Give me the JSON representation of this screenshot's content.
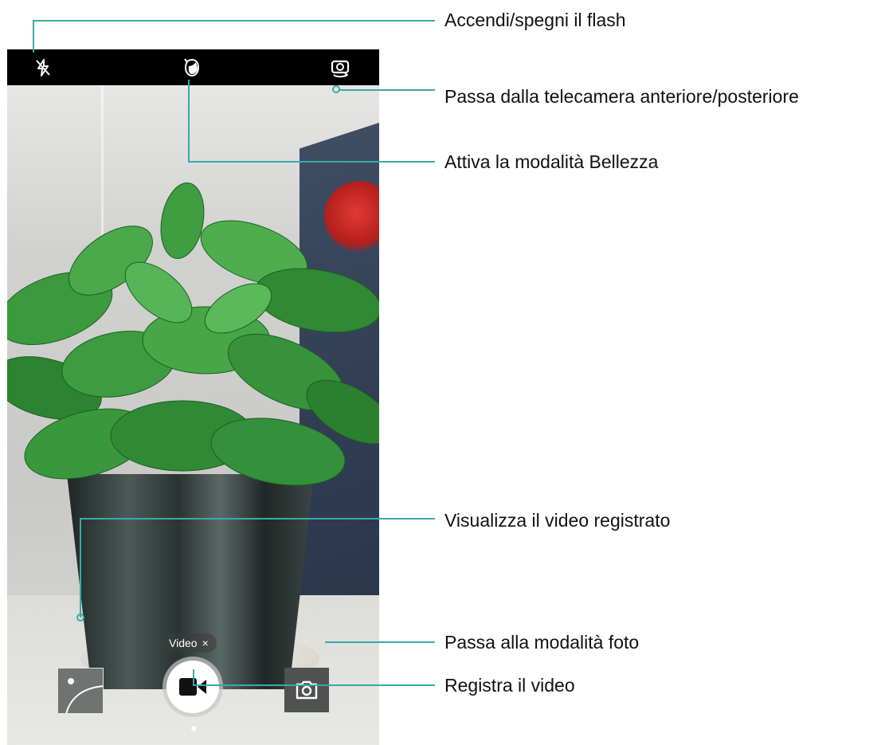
{
  "callouts": {
    "flash": "Accendi/spegni il flash",
    "switch_camera": "Passa dalla telecamera anteriore/posteriore",
    "beauty": "Attiva la modalità Bellezza",
    "view_video": "Visualizza il video registrato",
    "photo_mode": "Passa alla modalità foto",
    "record": "Registra il video"
  },
  "camera": {
    "mode_chip": "Video",
    "mode_chip_close": "×"
  },
  "icons": {
    "flash": "flash-off-icon",
    "beauty": "beauty-icon",
    "switch": "switch-camera-icon",
    "record": "video-camera-icon",
    "photo": "camera-icon",
    "gallery": "gallery-thumbnail"
  },
  "colors": {
    "callout_line": "#3aa9a9",
    "topbar": "#000000"
  }
}
